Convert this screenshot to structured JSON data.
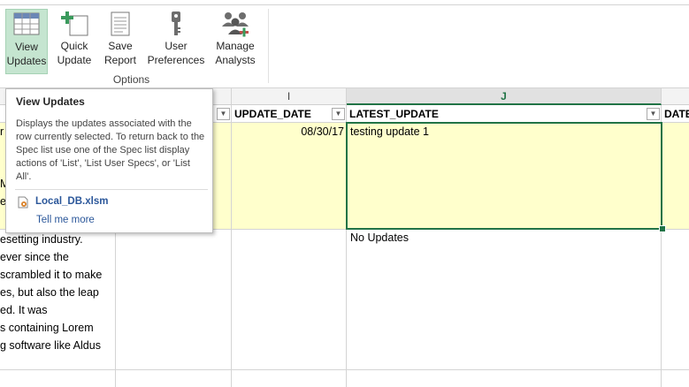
{
  "ribbon": {
    "buttons": [
      {
        "line1": "View",
        "line2": "Updates"
      },
      {
        "line1": "Quick",
        "line2": "Update"
      },
      {
        "line1": "Save",
        "line2": "Report"
      },
      {
        "line1": "User",
        "line2": "Preferences"
      },
      {
        "line1": "Manage",
        "line2": "Analysts"
      }
    ],
    "group_label": "Options"
  },
  "grid": {
    "columns": {
      "i": "I",
      "j": "J"
    },
    "headers": {
      "update_date": "UPDATE_DATE",
      "latest_update": "LATEST_UPDATE",
      "date_partial": "DATE"
    },
    "row1": {
      "update_date": "08/30/17",
      "latest_update": "testing update 1",
      "col_a_fragment1": "r",
      "col_a_fragment2": "M",
      "col_a_fragment3": "e"
    },
    "row2": {
      "latest_update": "No Updates"
    },
    "lorem_lines": [
      "esetting industry.",
      "ever since the",
      "scrambled it to make",
      "es, but also the leap",
      "ed. It was",
      "s containing Lorem",
      "g software like Aldus"
    ]
  },
  "tooltip": {
    "title": "View Updates",
    "body": "Displays the updates associated with the row currently selected. To return back to the Spec list use one of the Spec list display actions of 'List', 'List User Specs', or 'List All'.",
    "file": "Local_DB.xlsm",
    "tell_more": "Tell me more"
  },
  "colors": {
    "accent": "#217346",
    "highlight": "#ffffcc",
    "link": "#2b579a"
  }
}
